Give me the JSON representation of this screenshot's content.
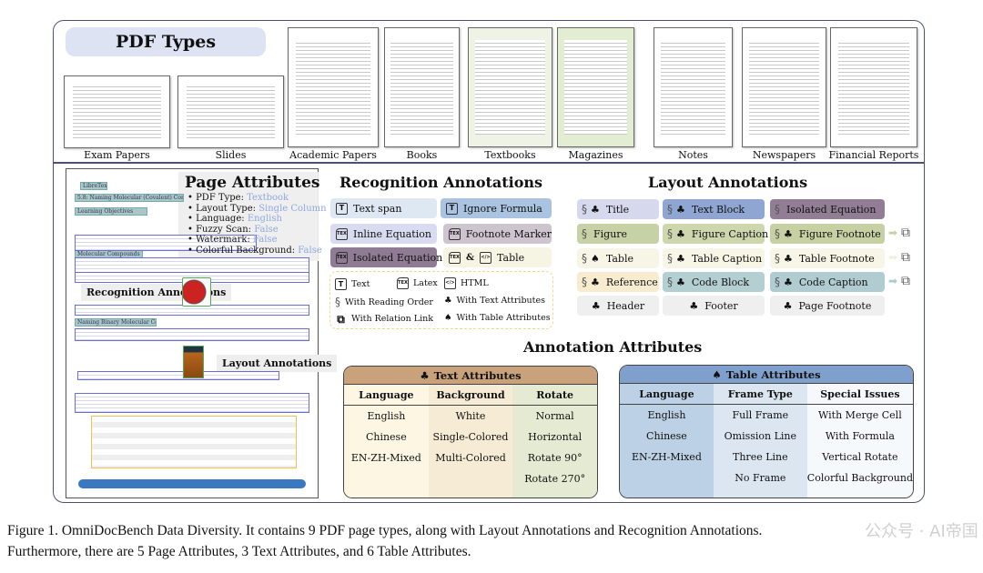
{
  "pdf_types": {
    "title": "PDF Types",
    "items": [
      "Exam Papers",
      "Slides",
      "Academic Papers",
      "Books",
      "Textbooks",
      "Magazines",
      "Notes",
      "Newspapers",
      "Financial Reports"
    ]
  },
  "page_example": {
    "headings": [
      "LibreTexts",
      "5.8: Naming Molecular (Covalent) Compounds",
      "Learning Objectives",
      "Molecular Compounds",
      "Naming Binary Molecular Compounds"
    ],
    "recognition_tag": "Recognition Annotations",
    "layout_tag": "Layout Annotations"
  },
  "page_attributes": {
    "title": "Page Attributes",
    "items": [
      {
        "key": "PDF Type:",
        "value": "Textbook"
      },
      {
        "key": "Layout Type:",
        "value": "Single Column"
      },
      {
        "key": "Language:",
        "value": "English"
      },
      {
        "key": "Fuzzy Scan:",
        "value": "False"
      },
      {
        "key": "Watermark:",
        "value": "False"
      },
      {
        "key": "Colorful Background:",
        "value": "False"
      }
    ]
  },
  "recognition": {
    "title": "Recognition Annotations",
    "items": [
      {
        "label": "Text span",
        "icon": "text-icon",
        "color": "#dde8f3"
      },
      {
        "label": "Ignore Formula",
        "icon": "text-icon",
        "color": "#a9c3e0"
      },
      {
        "label": "Inline Equation",
        "icon": "tex-icon",
        "color": "#d9dcf0"
      },
      {
        "label": "Footnote Marker",
        "icon": "tex-icon",
        "color": "#cdc4cf"
      },
      {
        "label": "Isolated Equation",
        "icon": "tex-icon",
        "color": "#8f7b94"
      },
      {
        "label": "Table",
        "icon": "tex-html-icon",
        "color": "#f6f4e2",
        "amp": "&"
      }
    ],
    "legend": [
      {
        "label": "Text",
        "icon": "text-icon"
      },
      {
        "label": "Latex",
        "icon": "tex-icon"
      },
      {
        "label": "HTML",
        "icon": "html-icon"
      },
      {
        "label": "With Reading Order",
        "icon": "reading-order-icon"
      },
      {
        "label": "With Text Attributes",
        "icon": "club-icon"
      },
      {
        "label": "With Relation Link",
        "icon": "relation-link-icon"
      },
      {
        "label": "With Table Attributes",
        "icon": "spade-icon"
      }
    ]
  },
  "layout": {
    "title": "Layout Annotations",
    "items": [
      {
        "label": "Title",
        "order": true,
        "attr": "club",
        "color": "#d6d8ee"
      },
      {
        "label": "Text Block",
        "order": true,
        "attr": "club",
        "color": "#8ea6d1"
      },
      {
        "label": "Isolated Equation",
        "order": true,
        "attr": "",
        "color": "#917e95"
      },
      {
        "label": "Figure",
        "order": true,
        "attr": "",
        "color": "#c7d1a6"
      },
      {
        "label": "Figure Caption",
        "order": true,
        "attr": "club",
        "color": "#cdd6ad"
      },
      {
        "label": "Figure Footnote",
        "order": true,
        "attr": "club",
        "color": "#c6d0a2",
        "link": true,
        "arrow_color": "#c6d0a2"
      },
      {
        "label": "Table",
        "order": true,
        "attr": "spade",
        "color": "#f7f5e6"
      },
      {
        "label": "Table Caption",
        "order": true,
        "attr": "club",
        "color": "#f7f5e6"
      },
      {
        "label": "Table Footnote",
        "order": true,
        "attr": "club",
        "color": "#f7f5e6",
        "link": true,
        "arrow_color": "#f1efdc"
      },
      {
        "label": "Reference",
        "order": true,
        "attr": "club",
        "color": "#f7ecd0"
      },
      {
        "label": "Code Block",
        "order": true,
        "attr": "club",
        "color": "#b3cfd2"
      },
      {
        "label": "Code Caption",
        "order": true,
        "attr": "club",
        "color": "#b0ccd0",
        "link": true,
        "arrow_color": "#a9cad0"
      },
      {
        "label": "Header",
        "order": false,
        "attr": "club",
        "color": "#efefef"
      },
      {
        "label": "Footer",
        "order": false,
        "attr": "club",
        "color": "#efefef"
      },
      {
        "label": "Page Footnote",
        "order": false,
        "attr": "club",
        "color": "#efefef"
      }
    ]
  },
  "attributes": {
    "title": "Annotation Attributes",
    "text_attributes": {
      "title": "Text Attributes",
      "icon": "club-icon",
      "header_color": "#c9a27b",
      "columns": [
        {
          "header": "Language",
          "values": [
            "English",
            "Chinese",
            "EN-ZH-Mixed"
          ],
          "color": "#fcf6e3"
        },
        {
          "header": "Background",
          "values": [
            "White",
            "Single-Colored",
            "Multi-Colored"
          ],
          "color": "#f6ebd4"
        },
        {
          "header": "Rotate",
          "values": [
            "Normal",
            "Horizontal",
            "Rotate 90°",
            "Rotate 270°"
          ],
          "color": "#e5ebd3"
        }
      ]
    },
    "table_attributes": {
      "title": "Table Attributes",
      "icon": "spade-icon",
      "header_color": "#7fa0cc",
      "columns": [
        {
          "header": "Language",
          "values": [
            "English",
            "Chinese",
            "EN-ZH-Mixed"
          ],
          "color": "#bcd1e5"
        },
        {
          "header": "Frame Type",
          "values": [
            "Full Frame",
            "Omission Line",
            "Three Line",
            "No Frame"
          ],
          "color": "#dbe6f1"
        },
        {
          "header": "Special Issues",
          "values": [
            "With Merge Cell",
            "With Formula",
            "Vertical Rotate",
            "Colorful Background"
          ],
          "color": "#f6f9fb"
        }
      ]
    }
  },
  "caption": {
    "line1": "Figure 1.  OmniDocBench Data Diversity.  It contains 9 PDF page types, along with Layout Annotations and Recognition Annotations.",
    "line2": "Furthermore, there are 5 Page Attributes, 3 Text Attributes, and 6 Table Attributes."
  },
  "watermark": "公众号 · AI帝国"
}
